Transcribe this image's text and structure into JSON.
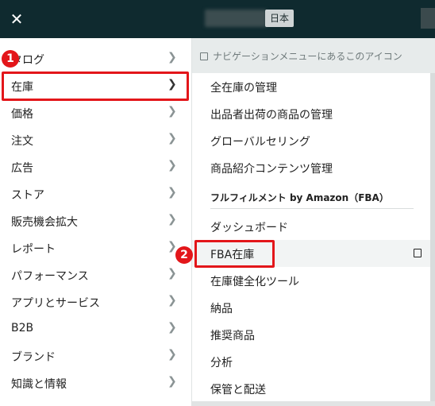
{
  "header": {
    "language_label": "日本"
  },
  "background_notice": "ナビゲーションメニューにあるこのアイコン",
  "left_menu": {
    "close_icon": "close-icon",
    "items": [
      {
        "label": "タログ"
      },
      {
        "label": "在庫"
      },
      {
        "label": "価格"
      },
      {
        "label": "注文"
      },
      {
        "label": "広告"
      },
      {
        "label": "ストア"
      },
      {
        "label": "販売機会拡大"
      },
      {
        "label": "レポート"
      },
      {
        "label": "パフォーマンス"
      },
      {
        "label": "アプリとサービス"
      },
      {
        "label": "B2B"
      },
      {
        "label": "ブランド"
      },
      {
        "label": "知識と情報"
      }
    ],
    "selected_item": "在庫"
  },
  "sub_menu": {
    "items_top": [
      {
        "label": "全在庫の管理"
      },
      {
        "label": "出品者出荷の商品の管理"
      },
      {
        "label": "グローバルセリング"
      },
      {
        "label": "商品紹介コンテンツ管理"
      }
    ],
    "section_title": "フルフィルメント by Amazon（FBA）",
    "items_fba": [
      {
        "label": "ダッシュボード"
      },
      {
        "label": "FBA在庫"
      },
      {
        "label": "在庫健全化ツール"
      },
      {
        "label": "納品"
      },
      {
        "label": "推奨商品"
      },
      {
        "label": "分析"
      },
      {
        "label": "保管と配送"
      }
    ],
    "active_item": "FBA在庫"
  },
  "annotations": {
    "badge_1": "1",
    "badge_2": "2"
  },
  "colors": {
    "header_bg": "#0f2a2f",
    "highlight": "#e3161a",
    "active_row": "#f2f4f4"
  }
}
